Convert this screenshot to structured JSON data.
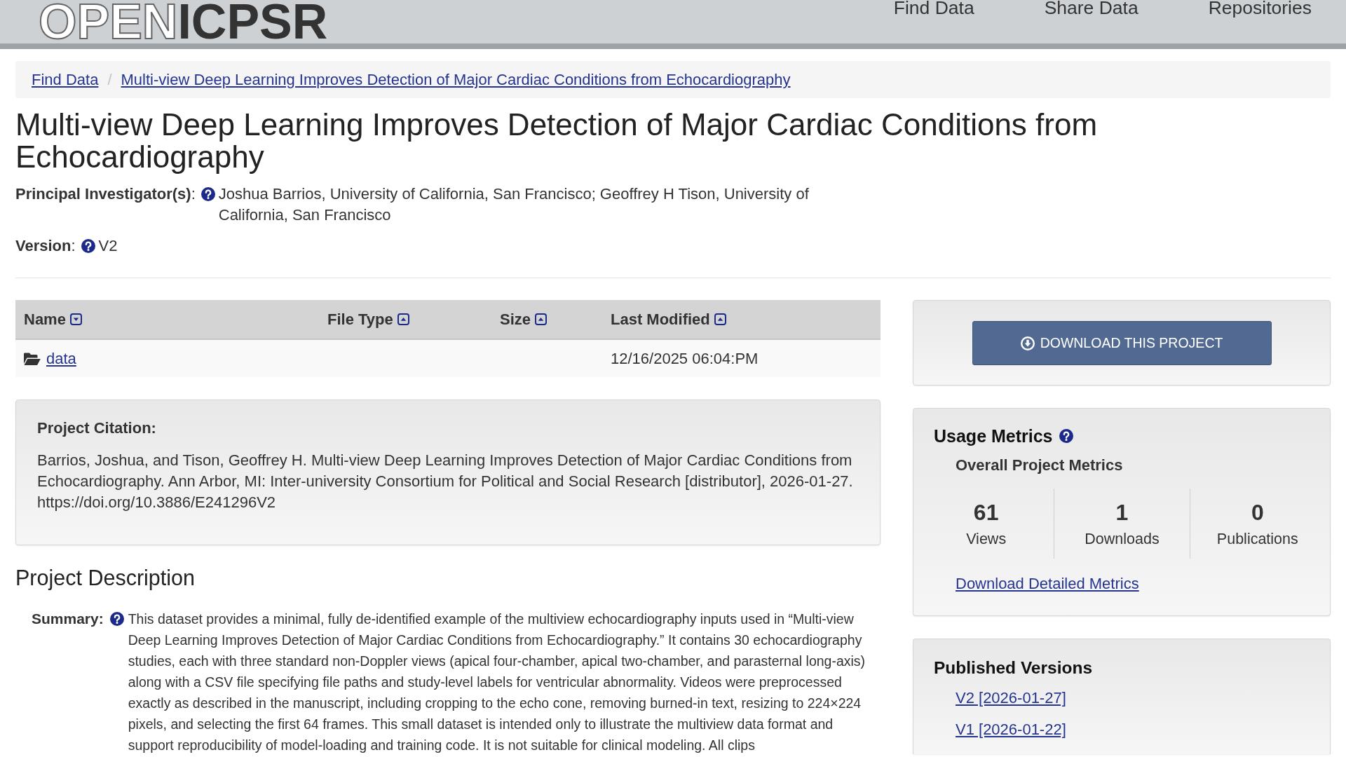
{
  "header": {
    "logo": [
      "OPEN",
      "ICPSR"
    ],
    "nav": [
      "Find Data",
      "Share Data",
      "Repositories"
    ]
  },
  "breadcrumb": {
    "items": [
      "Find Data",
      "Multi-view Deep Learning Improves Detection of Major Cardiac Conditions from Echocardiography"
    ],
    "separator": "/"
  },
  "title": "Multi-view Deep Learning Improves Detection of Major Cardiac Conditions from Echocardiography",
  "principal_investigators": {
    "label": "**Principal Investigator(s)**:",
    "value": "Joshua Barrios, University of California, San Francisco; Geoffrey H Tison, University of California, San Francisco"
  },
  "version": {
    "label": "**Version**:",
    "value": "V2"
  },
  "file_table": {
    "columns": [
      {
        "label": "Name",
        "sort_down": true
      },
      {
        "label": "File Type",
        "sort_down": false
      },
      {
        "label": "Size",
        "sort_down": false
      },
      {
        "label": "Last Modified",
        "sort_down": false
      }
    ],
    "rows": [
      {
        "name": "data",
        "last_modified": "12/16/2025 06:04:PM"
      }
    ]
  },
  "citation": {
    "heading": "Project Citation:",
    "text": "Barrios, Joshua, and Tison, Geoffrey H. Multi-view Deep Learning Improves Detection of Major Cardiac Conditions from Echocardiography. Ann Arbor, MI: Inter-university Consortium for Political and Social Research [distributor], 2026-01-27. https://doi.org/10.3886/E241296V2"
  },
  "description": {
    "heading": "Project Description",
    "summary_label": "Summary:",
    "summary": "This dataset provides a minimal, fully de-identified example of the multiview echocardiography inputs used in “Multi-view Deep Learning Improves Detection of Major Cardiac Conditions from Echocardiography.” It contains 30 echocardiography studies, each with three standard non-Doppler views (apical four-chamber, apical two-chamber, and parasternal long-axis) along with a CSV file specifying file paths and study-level labels for ventricular abnormality. Videos were preprocessed exactly as described in the manuscript, including cropping to the echo cone, removing burned-in text, resizing to 224×224 pixels, and selecting the first 64 frames. This small dataset is intended only to illustrate the multiview data format and support reproducibility of model-loading and training code. It is not suitable for clinical modeling. All clips"
  },
  "download_button": "DOWNLOAD THIS PROJECT",
  "usage_metrics": {
    "title": "Usage Metrics",
    "subtitle": "Overall Project Metrics",
    "metrics": [
      {
        "value": "61",
        "label": "Views"
      },
      {
        "value": "1",
        "label": "Downloads"
      },
      {
        "value": "0",
        "label": "Publications"
      }
    ],
    "link": "Download Detailed Metrics"
  },
  "published_versions": {
    "title": "Published Versions",
    "versions": [
      "V2 [2026-01-27]",
      "V1 [2026-01-22]"
    ]
  }
}
